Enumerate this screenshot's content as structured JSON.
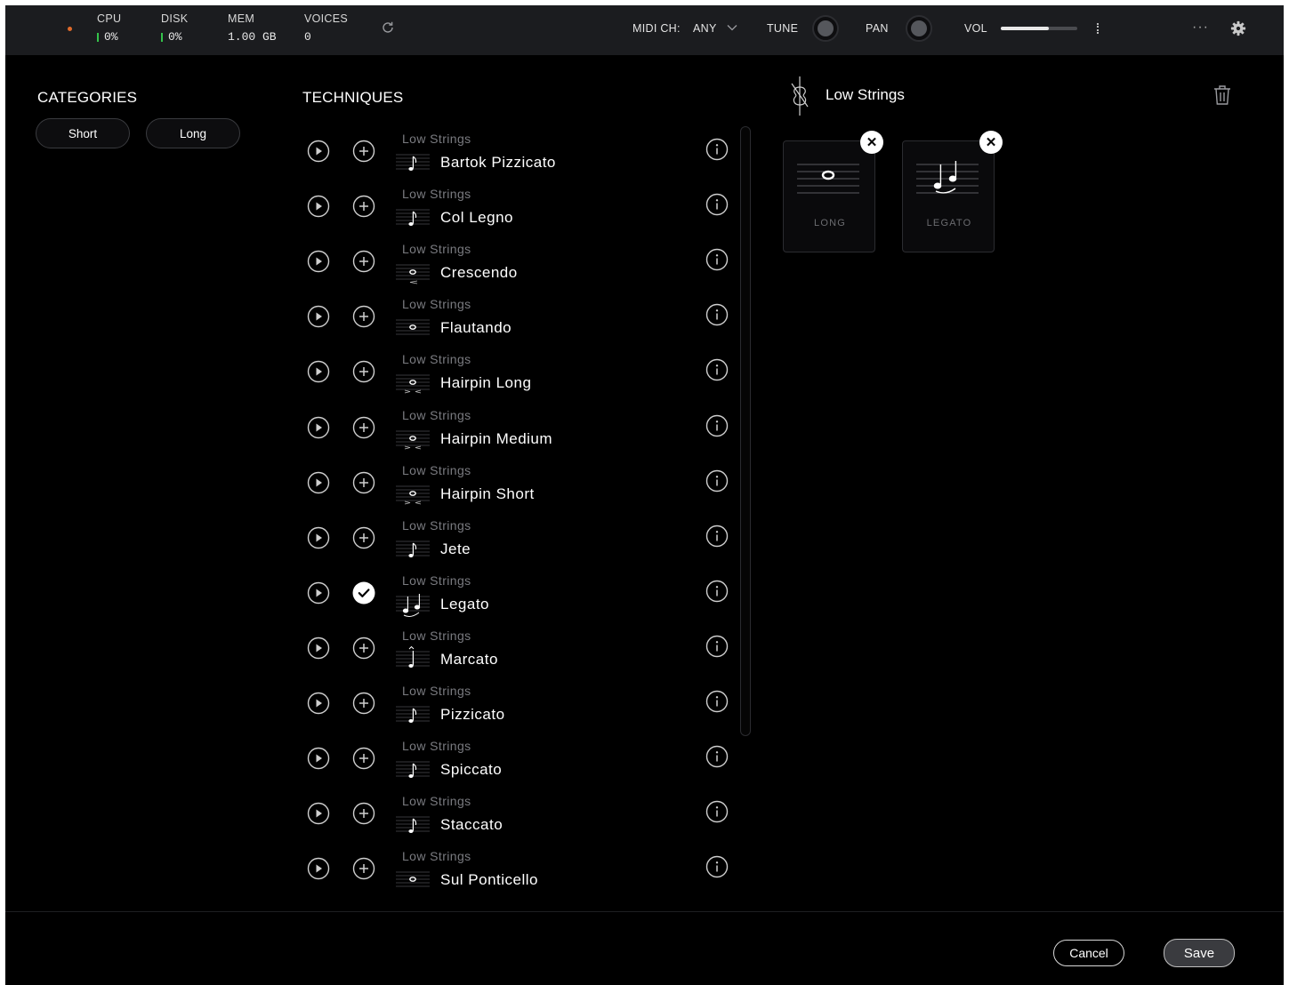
{
  "topbar": {
    "cpu_label": "CPU",
    "cpu_value": "0%",
    "disk_label": "DISK",
    "disk_value": "0%",
    "mem_label": "MEM",
    "mem_value": "1.00 GB",
    "voices_label": "VOICES",
    "voices_value": "0",
    "midi_label": "MIDI CH:",
    "midi_value": "ANY",
    "tune_label": "TUNE",
    "pan_label": "PAN",
    "vol_label": "VOL",
    "vol_level": 0.63,
    "more_label": "···"
  },
  "categories": {
    "title": "CATEGORIES",
    "items": [
      "Short",
      "Long"
    ]
  },
  "techniques": {
    "title": "TECHNIQUES",
    "items": [
      {
        "sub": "Low Strings",
        "name": "Bartok Pizzicato",
        "glyph": "bartok",
        "added": false
      },
      {
        "sub": "Low Strings",
        "name": "Col Legno",
        "glyph": "col legno",
        "added": false
      },
      {
        "sub": "Low Strings",
        "name": "Crescendo",
        "glyph": "cresc",
        "added": false
      },
      {
        "sub": "Low Strings",
        "name": "Flautando",
        "glyph": "flaut",
        "added": false
      },
      {
        "sub": "Low Strings",
        "name": "Hairpin Long",
        "glyph": "long",
        "added": false
      },
      {
        "sub": "Low Strings",
        "name": "Hairpin Medium",
        "glyph": "medium",
        "added": false
      },
      {
        "sub": "Low Strings",
        "name": "Hairpin Short",
        "glyph": "short",
        "added": false
      },
      {
        "sub": "Low Strings",
        "name": "Jete",
        "glyph": "jeté",
        "added": false
      },
      {
        "sub": "Low Strings",
        "name": "Legato",
        "glyph": "legato",
        "added": true
      },
      {
        "sub": "Low Strings",
        "name": "Marcato",
        "glyph": "marcato",
        "added": false
      },
      {
        "sub": "Low Strings",
        "name": "Pizzicato",
        "glyph": "pizz",
        "added": false
      },
      {
        "sub": "Low Strings",
        "name": "Spiccato",
        "glyph": "spiccato",
        "added": false
      },
      {
        "sub": "Low Strings",
        "name": "Staccato",
        "glyph": "staccato",
        "added": false
      },
      {
        "sub": "Low Strings",
        "name": "Sul Ponticello",
        "glyph": "sul pont",
        "added": false
      }
    ]
  },
  "selection": {
    "instrument": "Low Strings",
    "cards": [
      {
        "caption": "LONG",
        "glyph": "whole-note"
      },
      {
        "caption": "LEGATO",
        "glyph": "legato"
      }
    ]
  },
  "footer": {
    "cancel": "Cancel",
    "save": "Save"
  },
  "colors": {
    "background": "#000000",
    "topbar": "#1b1c1f",
    "meter_green": "#33c24a",
    "record_dot": "#e06a2a",
    "subtext": "#7a7b80"
  }
}
